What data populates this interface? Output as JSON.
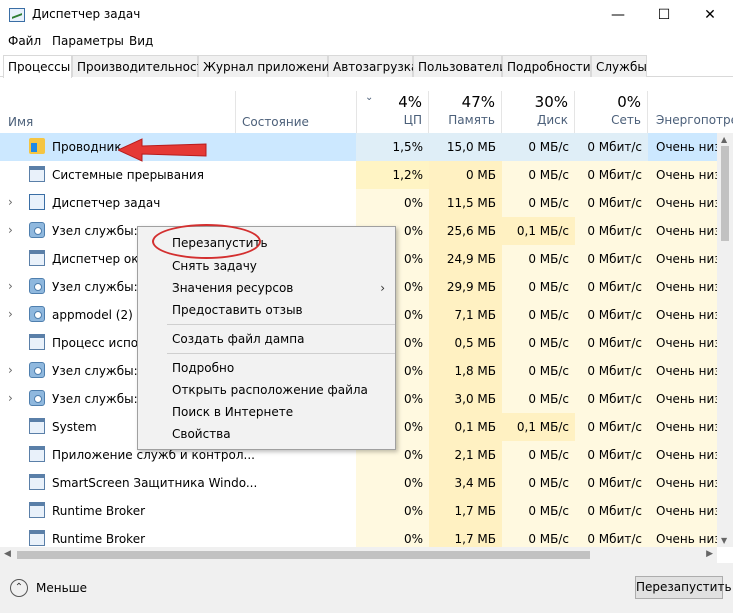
{
  "window": {
    "title": "Диспетчер задач",
    "controls": {
      "minimize": "—",
      "maximize": "☐",
      "close": "✕"
    }
  },
  "menu": [
    "Файл",
    "Параметры",
    "Вид"
  ],
  "tabs": [
    "Процессы",
    "Производительность",
    "Журнал приложений",
    "Автозагрузка",
    "Пользователи",
    "Подробности",
    "Службы"
  ],
  "columns": {
    "name": "Имя",
    "status": "Состояние",
    "cpu": {
      "pct": "4%",
      "label": "ЦП"
    },
    "memory": {
      "pct": "47%",
      "label": "Память"
    },
    "disk": {
      "pct": "30%",
      "label": "Диск"
    },
    "network": {
      "pct": "0%",
      "label": "Сеть"
    },
    "energy": {
      "label": "Энергопотре..."
    }
  },
  "rows": [
    {
      "name": "Проводник",
      "icon": "explorer-icon",
      "expand": "",
      "cpu": "1,5%",
      "mem": "15,0 МБ",
      "disk": "0 МБ/с",
      "net": "0 Мбит/с",
      "energy": "Очень низк"
    },
    {
      "name": "Системные прерывания",
      "icon": "window-icon",
      "expand": "",
      "cpu": "1,2%",
      "mem": "0 МБ",
      "disk": "0 МБ/с",
      "net": "0 Мбит/с",
      "energy": "Очень низк"
    },
    {
      "name": "Диспетчер задач",
      "icon": "task-manager-icon",
      "expand": "›",
      "cpu": "0%",
      "mem": "11,5 МБ",
      "disk": "0 МБ/с",
      "net": "0 Мбит/с",
      "energy": "Очень низк"
    },
    {
      "name": "Узел службы: л",
      "icon": "gear-icon",
      "expand": "›",
      "cpu": "0%",
      "mem": "25,6 МБ",
      "disk": "0,1 МБ/с",
      "net": "0 Мбит/с",
      "energy": "Очень низк"
    },
    {
      "name": "Диспетчер окон",
      "icon": "window-icon",
      "expand": "",
      "cpu": "0%",
      "mem": "24,9 МБ",
      "disk": "0 МБ/с",
      "net": "0 Мбит/с",
      "energy": "Очень низк"
    },
    {
      "name": "Узел службы: л",
      "icon": "gear-icon",
      "expand": "›",
      "cpu": "0%",
      "mem": "29,9 МБ",
      "disk": "0 МБ/с",
      "net": "0 Мбит/с",
      "energy": "Очень низк"
    },
    {
      "name": "appmodel (2)",
      "icon": "gear-icon",
      "expand": "›",
      "cpu": "0%",
      "mem": "7,1 МБ",
      "disk": "0 МБ/с",
      "net": "0 Мбит/с",
      "energy": "Очень низк"
    },
    {
      "name": "Процесс испол",
      "icon": "window-icon",
      "expand": "",
      "cpu": "0%",
      "mem": "0,5 МБ",
      "disk": "0 МБ/с",
      "net": "0 Мбит/с",
      "energy": "Очень низк"
    },
    {
      "name": "Узел службы: с",
      "icon": "gear-icon",
      "expand": "›",
      "cpu": "0%",
      "mem": "1,8 МБ",
      "disk": "0 МБ/с",
      "net": "0 Мбит/с",
      "energy": "Очень низк"
    },
    {
      "name": "Узел службы: у",
      "icon": "gear-icon",
      "expand": "›",
      "cpu": "0%",
      "mem": "3,0 МБ",
      "disk": "0 МБ/с",
      "net": "0 Мбит/с",
      "energy": "Очень низк"
    },
    {
      "name": "System",
      "icon": "window-icon",
      "expand": "",
      "cpu": "0%",
      "mem": "0,1 МБ",
      "disk": "0,1 МБ/с",
      "net": "0 Мбит/с",
      "energy": "Очень низк"
    },
    {
      "name": "Приложение служб и контрол...",
      "icon": "window-icon",
      "expand": "",
      "cpu": "0%",
      "mem": "2,1 МБ",
      "disk": "0 МБ/с",
      "net": "0 Мбит/с",
      "energy": "Очень низк"
    },
    {
      "name": "SmartScreen Защитника Windo...",
      "icon": "window-icon",
      "expand": "",
      "cpu": "0%",
      "mem": "3,4 МБ",
      "disk": "0 МБ/с",
      "net": "0 Мбит/с",
      "energy": "Очень низк"
    },
    {
      "name": "Runtime Broker",
      "icon": "window-icon",
      "expand": "",
      "cpu": "0%",
      "mem": "1,7 МБ",
      "disk": "0 МБ/с",
      "net": "0 Мбит/с",
      "energy": "Очень низк"
    },
    {
      "name": "Runtime Broker",
      "icon": "window-icon",
      "expand": "",
      "cpu": "0%",
      "mem": "1,7 МБ",
      "disk": "0 МБ/с",
      "net": "0 Мбит/с",
      "energy": "Очень низк"
    }
  ],
  "context_menu": {
    "items": [
      "Перезапустить",
      "Снять задачу",
      "Значения ресурсов",
      "Предоставить отзыв",
      "Создать файл дампа",
      "Подробно",
      "Открыть расположение файла",
      "Поиск в Интернете",
      "Свойства"
    ],
    "submenu_glyph": "›"
  },
  "footer": {
    "fewer_label": "Меньше",
    "restart_button": "Перезапустить"
  },
  "colors": {
    "selection": "#cce8ff",
    "cpu_cell_hot": "#fff4c4",
    "cell_warm": "#fff9e0",
    "annotation_red": "#e53935"
  }
}
